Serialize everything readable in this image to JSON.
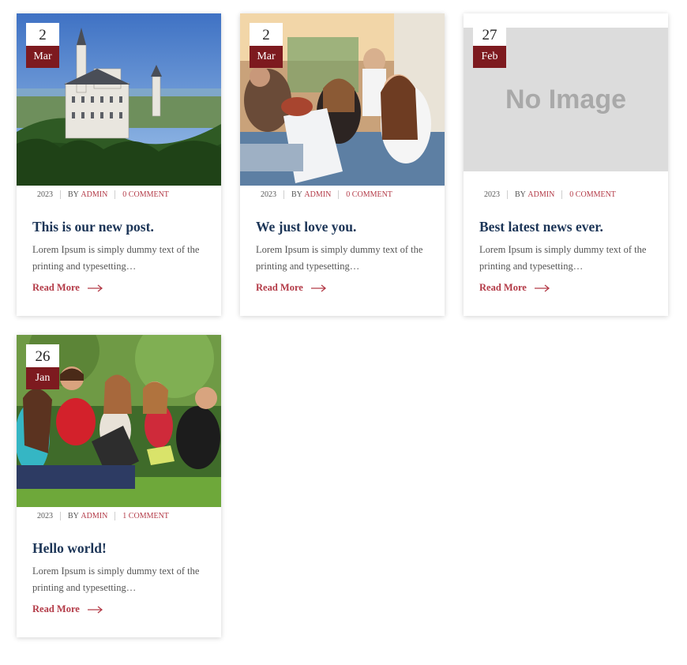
{
  "posts": [
    {
      "day": "2",
      "month": "Mar",
      "year": "2023",
      "by": "BY",
      "author": "ADMIN",
      "comments": "0 COMMENT",
      "title": "This is our new post.",
      "excerpt": "Lorem Ipsum is simply dummy text of the printing and typesetting…",
      "read_more": "Read More",
      "image": "castle-photo"
    },
    {
      "day": "2",
      "month": "Mar",
      "year": "2023",
      "by": "BY",
      "author": "ADMIN",
      "comments": "0 COMMENT",
      "title": "We just love you.",
      "excerpt": "Lorem Ipsum is simply dummy text of the printing and typesetting…",
      "read_more": "Read More",
      "image": "students-laptop-photo"
    },
    {
      "day": "27",
      "month": "Feb",
      "year": "2023",
      "by": "BY",
      "author": "ADMIN",
      "comments": "0 COMMENT",
      "title": "Best latest news ever.",
      "excerpt": "Lorem Ipsum is simply dummy text of the printing and typesetting…",
      "read_more": "Read More",
      "image": "no-image-placeholder",
      "placeholder_text": "No Image"
    },
    {
      "day": "26",
      "month": "Jan",
      "year": "2023",
      "by": "BY",
      "author": "ADMIN",
      "comments": "1 COMMENT",
      "title": "Hello world!",
      "excerpt": "Lorem Ipsum is simply dummy text of the printing and typesetting…",
      "read_more": "Read More",
      "image": "students-grass-photo"
    }
  ],
  "colors": {
    "date_bg": "#7d1a1f",
    "accent": "#b33a47",
    "title": "#1c3557"
  }
}
